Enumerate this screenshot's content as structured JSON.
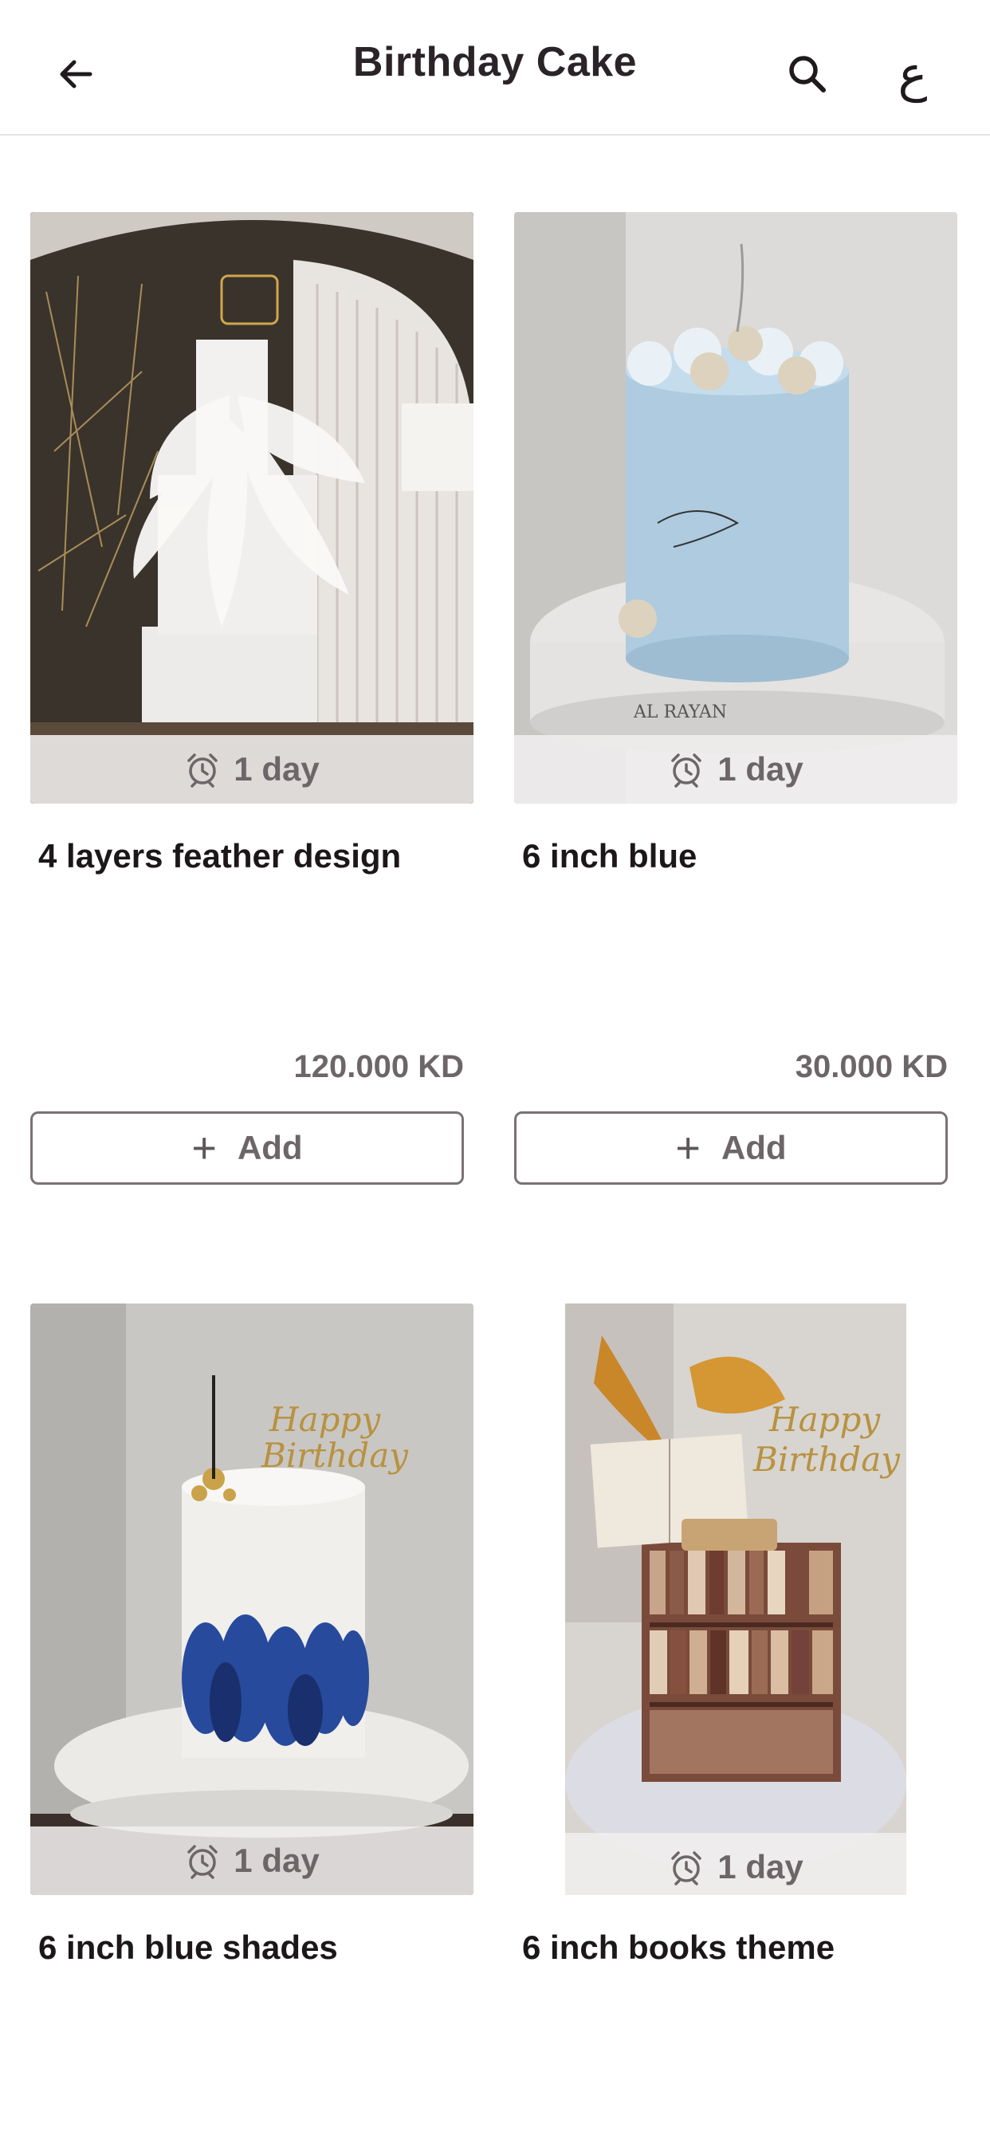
{
  "header": {
    "title": "Birthday Cake",
    "back_icon": "arrow-left-icon",
    "search_icon": "search-icon",
    "language_toggle": "ع"
  },
  "colors": {
    "text_primary": "#1c1719",
    "text_secondary": "#6d6669",
    "button_border": "#7a7275",
    "badge_background": "#f0eeee"
  },
  "products": [
    {
      "name": "4 layers feather design",
      "delivery_time": "1 day",
      "price": "120.000 KD",
      "add_label": "Add"
    },
    {
      "name": "6 inch blue",
      "delivery_time": "1 day",
      "price": "30.000 KD",
      "add_label": "Add"
    },
    {
      "name": "6 inch blue shades",
      "delivery_time": "1 day"
    },
    {
      "name": "6 inch books theme",
      "delivery_time": "1 day"
    }
  ]
}
